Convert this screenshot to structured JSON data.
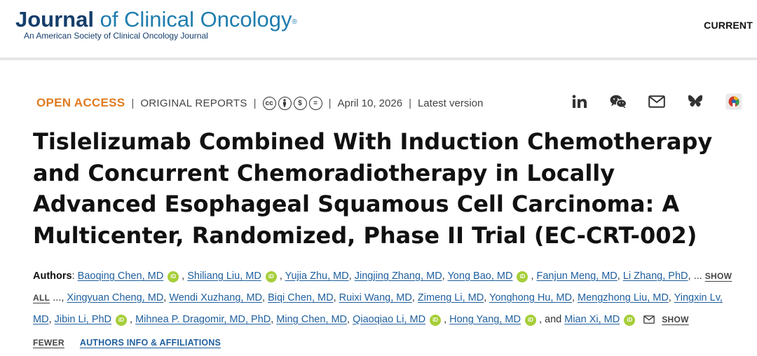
{
  "header": {
    "logo_bold": "Journal",
    "logo_rest": " of Clinical Oncology",
    "logo_reg": "®",
    "logo_sub": "An American Society of Clinical Oncology Journal",
    "current_label": "CURRENT"
  },
  "meta": {
    "open_access": "OPEN ACCESS",
    "sep": "|",
    "section": "ORIGINAL REPORTS",
    "license_icons": [
      "cc",
      "by",
      "nc",
      "nd"
    ],
    "date": "April 10, 2026",
    "version": "Latest version"
  },
  "share_icons": [
    "linkedin-icon",
    "wechat-icon",
    "email-icon",
    "bluesky-icon",
    "share-logo-icon"
  ],
  "title": "Tislelizumab Combined With Induction Chemotherapy and Concurrent Chemoradiotherapy in Locally Advanced Esophageal Squamous Cell Carcinoma: A Multicenter, Randomized, Phase II Trial (EC-CRT-002)",
  "authors": {
    "label": "Authors",
    "colon": ": ",
    "names": [
      "Baoqing Chen, MD",
      "Shiliang Liu, MD",
      "Yujia Zhu, MD",
      "Jingjing Zhang, MD",
      "Yong Bao, MD",
      "Fanjun Meng, MD",
      "Li Zhang, PhD",
      "Xingyuan Cheng, MD",
      "Wendi Xuzhang, MD",
      "Biqi Chen, MD",
      "Ruixi Wang, MD",
      "Zimeng Li, MD",
      "Yonghong Hu, MD",
      "Mengzhong Liu, MD",
      "Yingxin Lv, MD",
      "Jibin Li, PhD",
      "Mihnea P. Dragomir, MD, PhD",
      "Ming Chen, MD",
      "Qiaoqiao Li, MD",
      "Hong Yang, MD",
      "Mian Xi, MD"
    ],
    "ellipsis": "...",
    "show_all": "SHOW ALL",
    "and": "and",
    "show_fewer": "SHOW FEWER",
    "orcid": "iD",
    "affiliations": "AUTHORS INFO & AFFILIATIONS"
  }
}
